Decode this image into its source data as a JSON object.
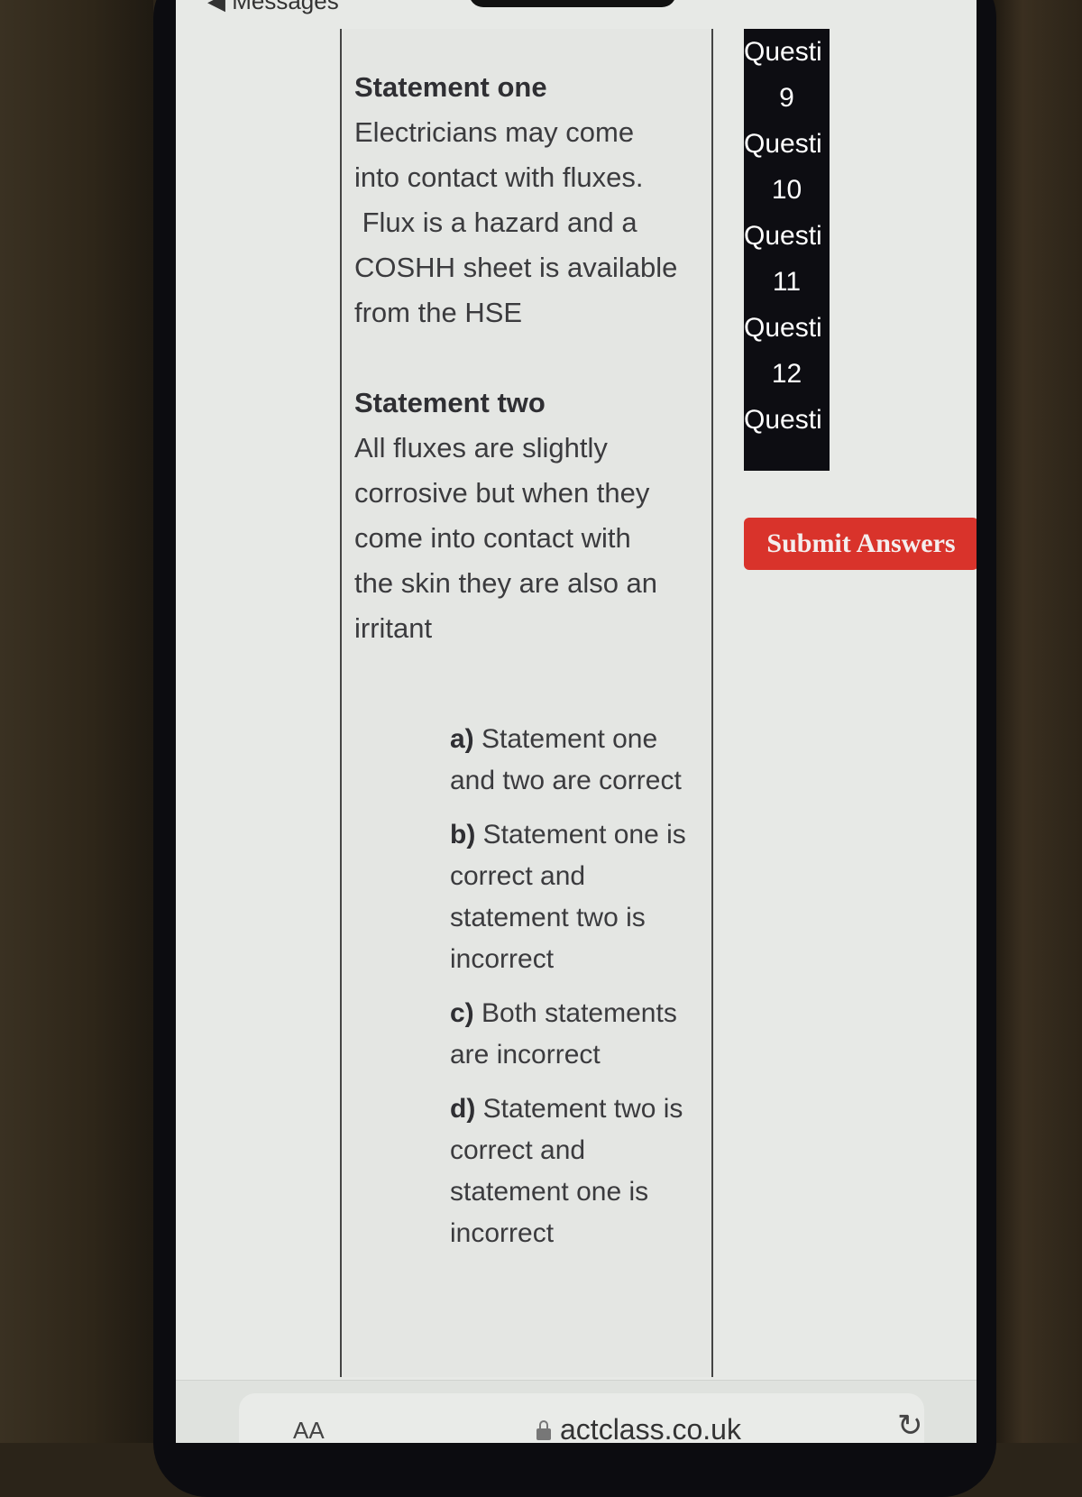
{
  "browser": {
    "back_label": "Messages",
    "text_size_label": "AA",
    "url": "actclass.co.uk",
    "reload_icon": "reload-icon",
    "lock_icon": "lock-icon"
  },
  "question": {
    "statement_one": {
      "heading": "Statement one",
      "lines": [
        "Electricians may come",
        "into contact with fluxes.",
        " Flux is a hazard and a",
        "COSHH sheet is available",
        "from the HSE"
      ]
    },
    "statement_two": {
      "heading": "Statement two",
      "lines": [
        "All fluxes are slightly",
        "corrosive but when they",
        "come into contact with",
        "the skin they are also an",
        "irritant"
      ]
    },
    "options": [
      {
        "letter": "a)",
        "text": "Statement one and two are correct"
      },
      {
        "letter": "b)",
        "text": "Statement one is correct and statement two is incorrect"
      },
      {
        "letter": "c)",
        "text": "Both statements are incorrect"
      },
      {
        "letter": "d)",
        "text": "Statement two is correct and statement one is incorrect"
      }
    ]
  },
  "question_nav": {
    "items": [
      {
        "label": "Questi",
        "number": "9"
      },
      {
        "label": "Questi",
        "number": "10"
      },
      {
        "label": "Questi",
        "number": "11"
      },
      {
        "label": "Questi",
        "number": "12"
      },
      {
        "label": "Questi",
        "number": ""
      }
    ]
  },
  "submit": {
    "label": "Submit Answers",
    "color": "#d9332b"
  }
}
